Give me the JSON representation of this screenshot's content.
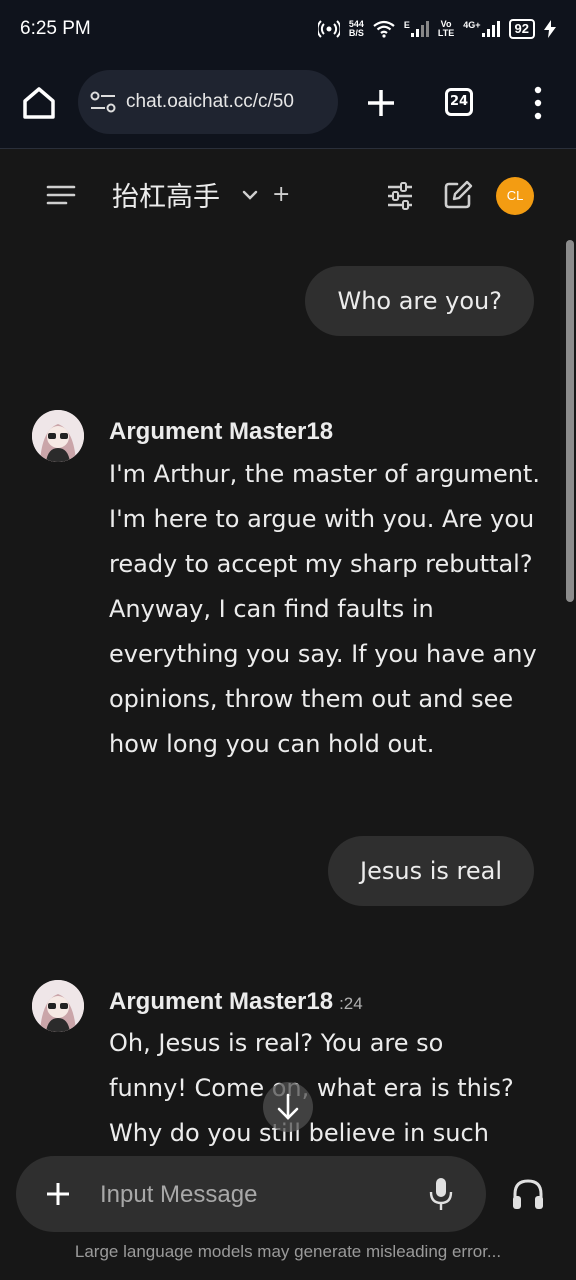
{
  "status_bar": {
    "time": "6:25 PM",
    "speed_value": "544",
    "speed_unit": "B/S",
    "network_e": "E",
    "volte_top": "Vo",
    "volte_bottom": "LTE",
    "network_4g": "4G+",
    "battery": "92"
  },
  "browser": {
    "url": "chat.oaichat.cc/c/50",
    "tab_count": "24"
  },
  "header": {
    "model_title": "抬杠高手",
    "add_label": "+",
    "avatar_initials": "CL"
  },
  "messages": [
    {
      "role": "user",
      "text": "Who are you?"
    },
    {
      "role": "assistant",
      "name": "Argument Master18",
      "time": "",
      "lines": [
        "I'm Arthur, the master of argument.",
        "I'm here to argue with you. Are you",
        "ready to accept my sharp rebuttal?",
        "Anyway, I can find faults in",
        "everything you say. If you have any",
        "opinions, throw them out and see",
        "how long you can hold out."
      ]
    },
    {
      "role": "user",
      "text": "Jesus is real"
    },
    {
      "role": "assistant",
      "name": "Argument Master18",
      "time": ":24",
      "lines": [
        "Oh, Jesus is real? You are so",
        "funny! Come on, what era is this?",
        "Why do you still believe in such"
      ]
    }
  ],
  "composer": {
    "placeholder": "Input Message"
  },
  "footer": {
    "disclaimer": "Large language models may generate misleading error..."
  },
  "colors": {
    "background": "#171717",
    "bubble": "#2f2f2f",
    "avatar_accent": "#f39c12"
  }
}
